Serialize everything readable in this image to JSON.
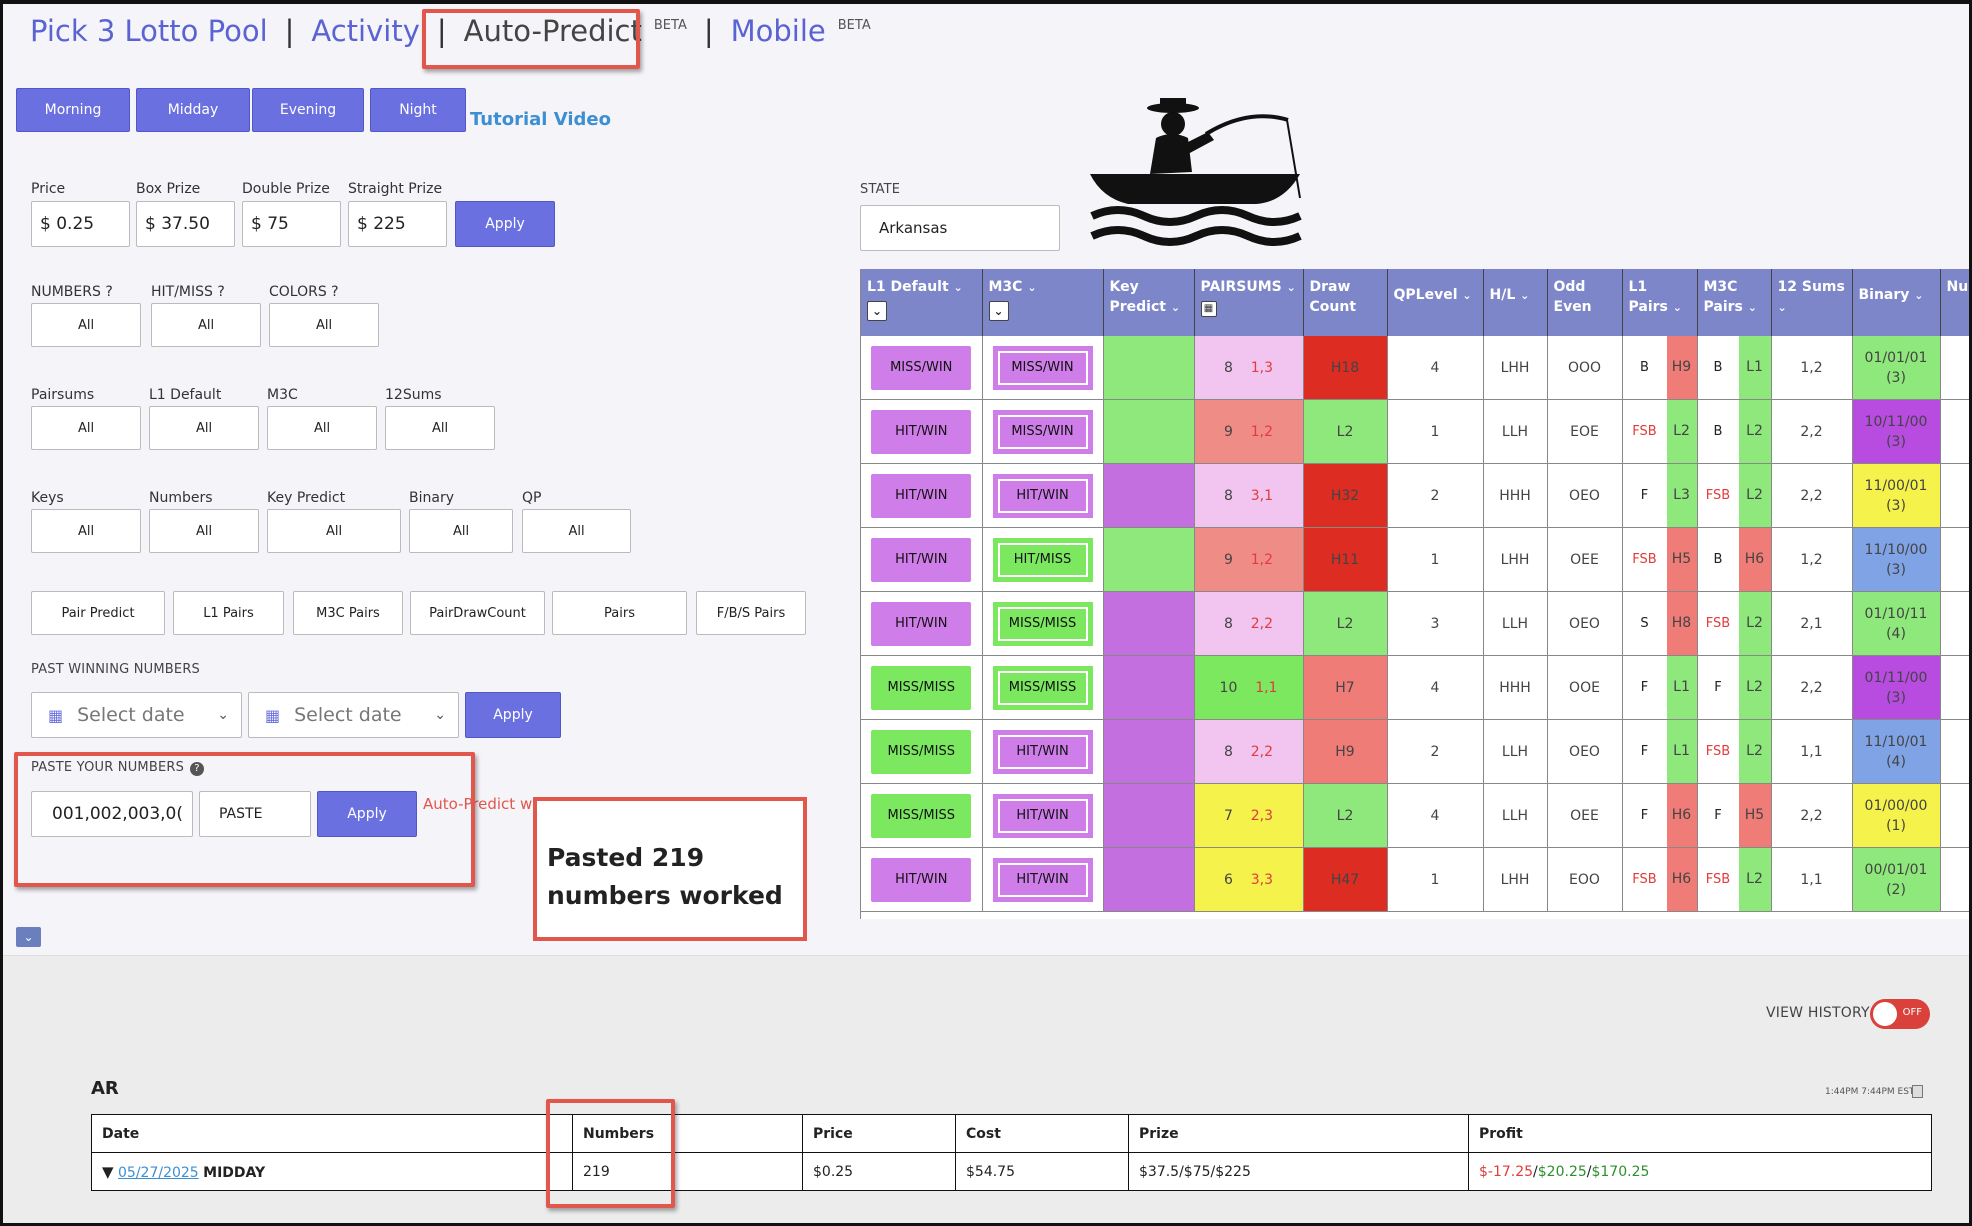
{
  "nav": {
    "brand": "Pick 3 Lotto Pool",
    "sep": "|",
    "activity": "Activity",
    "autopredict": "Auto-Predict",
    "beta1": "BETA",
    "mobile": "Mobile",
    "beta2": "BETA"
  },
  "draw_tabs": [
    "Morning",
    "Midday",
    "Evening",
    "Night"
  ],
  "tutorial": "Tutorial Video",
  "prices": {
    "price_label": "Price",
    "price": "$ 0.25",
    "box_label": "Box Prize",
    "box": "$ 37.50",
    "double_label": "Double Prize",
    "double": "$ 75",
    "straight_label": "Straight Prize",
    "straight": "$ 225",
    "apply": "Apply"
  },
  "filters1": [
    {
      "label": "NUMBERS ?",
      "value": "All"
    },
    {
      "label": "HIT/MISS ?",
      "value": "All"
    },
    {
      "label": "COLORS ?",
      "value": "All"
    }
  ],
  "filters2": [
    {
      "label": "Pairsums",
      "value": "All"
    },
    {
      "label": "L1 Default",
      "value": "All"
    },
    {
      "label": "M3C",
      "value": "All"
    },
    {
      "label": "12Sums",
      "value": "All"
    }
  ],
  "filters3": [
    {
      "label": "Keys",
      "value": "All"
    },
    {
      "label": "Numbers",
      "value": "All"
    },
    {
      "label": "Key Predict",
      "value": "All"
    },
    {
      "label": "Binary",
      "value": "All"
    },
    {
      "label": "QP",
      "value": "All"
    }
  ],
  "pair_buttons": [
    "Pair Predict",
    "L1 Pairs",
    "M3C Pairs",
    "PairDrawCount",
    "Pairs",
    "F/B/S Pairs"
  ],
  "past": {
    "label": "PAST WINNING NUMBERS",
    "from": "Select date",
    "to": "Select date",
    "apply": "Apply"
  },
  "paste": {
    "label": "PASTE YOUR NUMBERS",
    "value": "001,002,003,0(",
    "button": "PASTE",
    "apply": "Apply",
    "error": "Auto-Predict wi"
  },
  "note": "Pasted 219 numbers worked",
  "state": {
    "label": "STATE",
    "value": "Arkansas"
  },
  "grid": {
    "headers": [
      "L1 Default",
      "M3C",
      "Key Predict",
      "PAIRSUMS",
      "Draw Count",
      "QPLevel",
      "H/L",
      "Odd Even",
      "L1 Pairs",
      "M3C Pairs",
      "12 Sums",
      "Binary",
      "Nu"
    ],
    "rows": [
      {
        "l1": "MISS/WIN",
        "l1c": "#cf7de8",
        "m3": "MISS/WIN",
        "m3c": "#cf7de8",
        "kp": "#8ee87b",
        "ps": "8",
        "pp": "1,3",
        "psc": "#f1c5ef",
        "dc": "H18",
        "dcc": "#dd2c22",
        "qp": "4",
        "hl": "LHH",
        "oe": "OOO",
        "a": "B",
        "ac": "#222",
        "b": "H9",
        "bc": "#ef7c76",
        "c": "B",
        "cc": "#222",
        "d": "L1",
        "dc2": "#8ee87b",
        "s": "1,2",
        "bin": "01/01/01",
        "bn": "(3)",
        "binc": "#8ee87b"
      },
      {
        "l1": "HIT/WIN",
        "l1c": "#cf7de8",
        "m3": "MISS/WIN",
        "m3c": "#cf7de8",
        "kp": "#8ee87b",
        "ps": "9",
        "pp": "1,2",
        "psc": "#ef8c86",
        "dc": "L2",
        "dcc": "#8ee87b",
        "qp": "1",
        "hl": "LLH",
        "oe": "EOE",
        "a": "FSB",
        "ac": "#e23b3b",
        "b": "L2",
        "bc": "#8ee87b",
        "c": "B",
        "cc": "#222",
        "d": "L2",
        "dc2": "#8ee87b",
        "s": "2,2",
        "bin": "10/11/00",
        "bn": "(3)",
        "binc": "#b84be0"
      },
      {
        "l1": "HIT/WIN",
        "l1c": "#cf7de8",
        "m3": "HIT/WIN",
        "m3c": "#cf7de8",
        "kp": "#c36fe0",
        "ps": "8",
        "pp": "3,1",
        "psc": "#f1c5ef",
        "dc": "H32",
        "dcc": "#dd2c22",
        "qp": "2",
        "hl": "HHH",
        "oe": "OEO",
        "a": "F",
        "ac": "#222",
        "b": "L3",
        "bc": "#8ee87b",
        "c": "FSB",
        "cc": "#e23b3b",
        "d": "L2",
        "dc2": "#8ee87b",
        "s": "2,2",
        "bin": "11/00/01",
        "bn": "(3)",
        "binc": "#f5f24c"
      },
      {
        "l1": "HIT/WIN",
        "l1c": "#cf7de8",
        "m3": "HIT/MISS",
        "m3c": "#7be860",
        "kp": "#8ee87b",
        "ps": "9",
        "pp": "1,2",
        "psc": "#ef8c86",
        "dc": "H11",
        "dcc": "#dd2c22",
        "qp": "1",
        "hl": "LHH",
        "oe": "OEE",
        "a": "FSB",
        "ac": "#e23b3b",
        "b": "H5",
        "bc": "#ef7c76",
        "c": "B",
        "cc": "#222",
        "d": "H6",
        "dc2": "#ef7c76",
        "s": "1,2",
        "bin": "11/10/00",
        "bn": "(3)",
        "binc": "#7fa3e5"
      },
      {
        "l1": "HIT/WIN",
        "l1c": "#cf7de8",
        "m3": "MISS/MISS",
        "m3c": "#7be860",
        "kp": "#c36fe0",
        "ps": "8",
        "pp": "2,2",
        "psc": "#f1c5ef",
        "dc": "L2",
        "dcc": "#8ee87b",
        "qp": "3",
        "hl": "LLH",
        "oe": "OEO",
        "a": "S",
        "ac": "#222",
        "b": "H8",
        "bc": "#ef7c76",
        "c": "FSB",
        "cc": "#e23b3b",
        "d": "L2",
        "dc2": "#8ee87b",
        "s": "2,1",
        "bin": "01/10/11",
        "bn": "(4)",
        "binc": "#8ee87b"
      },
      {
        "l1": "MISS/MISS",
        "l1c": "#7be860",
        "m3": "MISS/MISS",
        "m3c": "#7be860",
        "kp": "#c36fe0",
        "ps": "10",
        "pp": "1,1",
        "psc": "#7be860",
        "dc": "H7",
        "dcc": "#ef7c76",
        "qp": "4",
        "hl": "HHH",
        "oe": "OOE",
        "a": "F",
        "ac": "#222",
        "b": "L1",
        "bc": "#8ee87b",
        "c": "F",
        "cc": "#222",
        "d": "L2",
        "dc2": "#8ee87b",
        "s": "2,2",
        "bin": "01/11/00",
        "bn": "(3)",
        "binc": "#b84be0"
      },
      {
        "l1": "MISS/MISS",
        "l1c": "#7be860",
        "m3": "HIT/WIN",
        "m3c": "#cf7de8",
        "kp": "#c36fe0",
        "ps": "8",
        "pp": "2,2",
        "psc": "#f1c5ef",
        "dc": "H9",
        "dcc": "#ef7c76",
        "qp": "2",
        "hl": "LLH",
        "oe": "OEO",
        "a": "F",
        "ac": "#222",
        "b": "L1",
        "bc": "#8ee87b",
        "c": "FSB",
        "cc": "#e23b3b",
        "d": "L2",
        "dc2": "#8ee87b",
        "s": "1,1",
        "bin": "11/10/01",
        "bn": "(4)",
        "binc": "#7fa3e5"
      },
      {
        "l1": "MISS/MISS",
        "l1c": "#7be860",
        "m3": "HIT/WIN",
        "m3c": "#cf7de8",
        "kp": "#c36fe0",
        "ps": "7",
        "pp": "2,3",
        "psc": "#f5f24c",
        "dc": "L2",
        "dcc": "#8ee87b",
        "qp": "4",
        "hl": "LLH",
        "oe": "OEE",
        "a": "F",
        "ac": "#222",
        "b": "H6",
        "bc": "#ef7c76",
        "c": "F",
        "cc": "#222",
        "d": "H5",
        "dc2": "#ef7c76",
        "s": "2,2",
        "bin": "01/00/00",
        "bn": "(1)",
        "binc": "#f5f24c"
      },
      {
        "l1": "HIT/WIN",
        "l1c": "#cf7de8",
        "m3": "HIT/WIN",
        "m3c": "#cf7de8",
        "kp": "#c36fe0",
        "ps": "6",
        "pp": "3,3",
        "psc": "#f5f24c",
        "dc": "H47",
        "dcc": "#dd2c22",
        "qp": "1",
        "hl": "LHH",
        "oe": "EOO",
        "a": "FSB",
        "ac": "#e23b3b",
        "b": "H6",
        "bc": "#ef7c76",
        "c": "FSB",
        "cc": "#e23b3b",
        "d": "L2",
        "dc2": "#8ee87b",
        "s": "1,1",
        "bin": "00/01/01",
        "bn": "(2)",
        "binc": "#8ee87b"
      }
    ]
  },
  "history": {
    "view_label": "VIEW HISTORY",
    "toggle": "OFF",
    "state": "AR",
    "times": "1:44PM 7:44PM EST",
    "columns": [
      "Date",
      "Numbers",
      "Price",
      "Cost",
      "Prize",
      "Profit"
    ],
    "row": {
      "arrow": "▼",
      "date": "05/27/2025",
      "draw": "MIDDAY",
      "numbers": "219",
      "price": "$0.25",
      "cost": "$54.75",
      "prize": "$37.5/$75/$225",
      "p1": "$-17.25",
      "p2": "$20.25",
      "p3": "$170.25"
    }
  }
}
